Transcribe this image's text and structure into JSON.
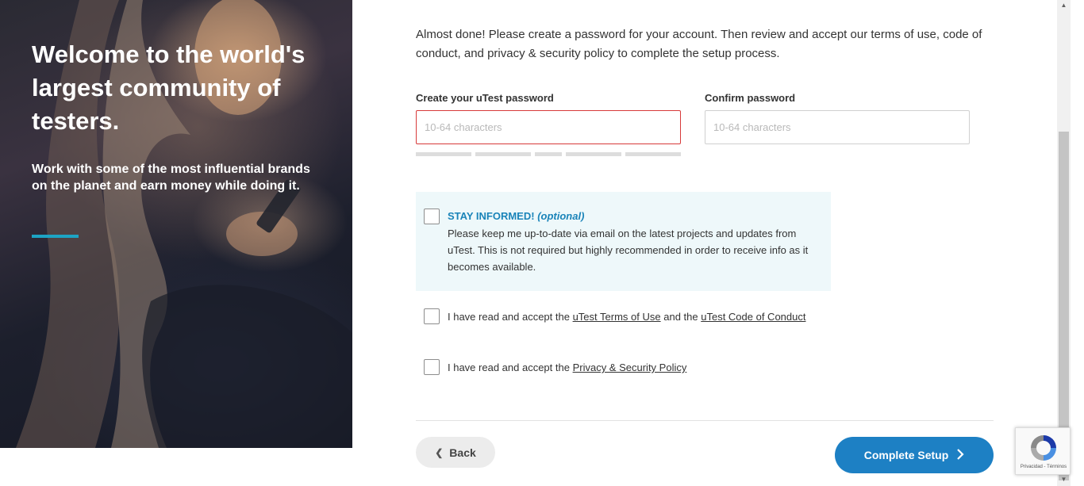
{
  "hero": {
    "title": "Welcome to the world's largest community of testers.",
    "subtitle": "Work with some of the most influential brands on the planet and earn money while doing it.",
    "accent_color": "#1da4c4"
  },
  "intro": "Almost done! Please create a password for your account. Then review and accept our terms of use, code of conduct, and privacy & security policy to complete the setup process.",
  "password": {
    "label": "Create your uTest password",
    "placeholder": "10-64 characters",
    "value": ""
  },
  "confirm": {
    "label": "Confirm password",
    "placeholder": "10-64 characters",
    "value": ""
  },
  "stay_informed": {
    "title": "STAY INFORMED!",
    "optional": "(optional)",
    "text": "Please keep me up-to-date via email on the latest projects and updates from uTest. This is not required but highly recommended in order to receive info as it becomes available.",
    "checked": false
  },
  "terms": {
    "prefix": "I have read and accept the",
    "link1": "uTest Terms of Use",
    "middle": "and the",
    "link2": "uTest Code of Conduct",
    "checked": false
  },
  "privacy": {
    "prefix": "I have read and accept the",
    "link": "Privacy & Security Policy",
    "checked": false
  },
  "buttons": {
    "back": "Back",
    "complete": "Complete Setup"
  },
  "recaptcha": {
    "links": "Privacidad - Términos"
  },
  "colors": {
    "primary": "#1d80c4",
    "error_border": "#d73a3a",
    "info_bg": "#eef8fa"
  }
}
